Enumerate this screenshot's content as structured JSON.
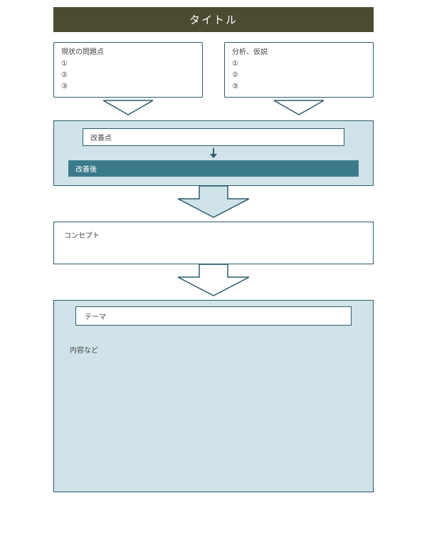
{
  "title": "タイトル",
  "problems": {
    "heading": "現状の問題点",
    "items": [
      "①",
      "②",
      "③"
    ]
  },
  "analysis": {
    "heading": "分析、仮説",
    "items": [
      "①",
      "②",
      "③"
    ]
  },
  "improvement": {
    "points_label": "改善点",
    "after_label": "改善後"
  },
  "concept_label": "コンセプト",
  "theme_label": "テーマ",
  "content_label": "内容など",
  "colors": {
    "title_bg": "#4b4b32",
    "border": "#2d5b6b",
    "light_panel": "#cfe3e9",
    "teal_bar": "#3b7a8b"
  }
}
